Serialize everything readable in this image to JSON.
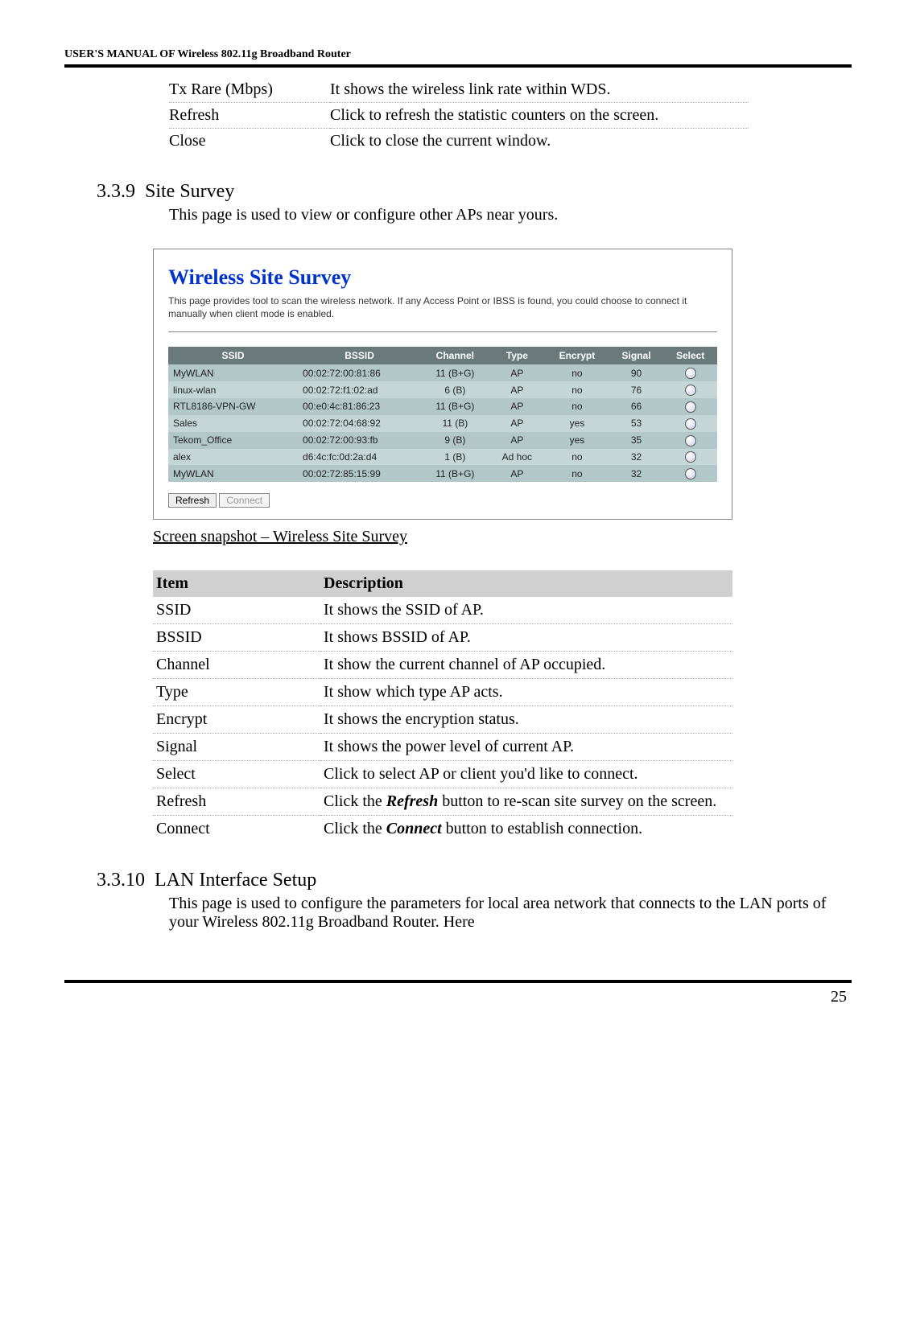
{
  "header": "USER'S MANUAL OF Wireless 802.11g Broadband Router",
  "top_defs": [
    {
      "k": "Tx Rare (Mbps)",
      "v": "It shows the wireless link rate within WDS."
    },
    {
      "k": "Refresh",
      "v": "Click to refresh the statistic counters on the screen."
    },
    {
      "k": "Close",
      "v": "Click to close the current window."
    }
  ],
  "section_survey": {
    "num": "3.3.9",
    "title": "Site Survey",
    "intro": "This page is used to view or configure other APs near yours."
  },
  "survey_panel": {
    "title": "Wireless Site Survey",
    "desc": "This page provides tool to scan the wireless network. If any Access Point or IBSS is found, you could choose to connect it manually when client mode is enabled.",
    "headers": [
      "SSID",
      "BSSID",
      "Channel",
      "Type",
      "Encrypt",
      "Signal",
      "Select"
    ],
    "rows": [
      [
        "MyWLAN",
        "00:02:72:00:81:86",
        "11 (B+G)",
        "AP",
        "no",
        "90"
      ],
      [
        "linux-wlan",
        "00:02:72:f1:02:ad",
        "6 (B)",
        "AP",
        "no",
        "76"
      ],
      [
        "RTL8186-VPN-GW",
        "00:e0:4c:81:86:23",
        "11 (B+G)",
        "AP",
        "no",
        "66"
      ],
      [
        "Sales",
        "00:02:72:04:68:92",
        "11 (B)",
        "AP",
        "yes",
        "53"
      ],
      [
        "Tekom_Office",
        "00:02:72:00:93:fb",
        "9 (B)",
        "AP",
        "yes",
        "35"
      ],
      [
        "alex",
        "d6:4c:fc:0d:2a:d4",
        "1 (B)",
        "Ad hoc",
        "no",
        "32"
      ],
      [
        "MyWLAN",
        "00:02:72:85:15:99",
        "11 (B+G)",
        "AP",
        "no",
        "32"
      ]
    ],
    "btn_refresh": "Refresh",
    "btn_connect": "Connect"
  },
  "caption": "Screen snapshot – Wireless Site Survey",
  "desc_table": {
    "headers": {
      "item": "Item",
      "desc": "Description"
    },
    "rows": [
      {
        "k": "SSID",
        "v": "It shows the SSID of AP."
      },
      {
        "k": "BSSID",
        "v": "It shows BSSID of AP."
      },
      {
        "k": "Channel",
        "v": "It show the current channel of AP occupied."
      },
      {
        "k": "Type",
        "v": "It show which type AP acts."
      },
      {
        "k": "Encrypt",
        "v": "It shows the encryption status."
      },
      {
        "k": "Signal",
        "v": "It shows the power level of current AP."
      },
      {
        "k": "Select",
        "v": "Click to select AP or client you'd like to connect."
      },
      {
        "k": "Refresh",
        "pre": "Click the ",
        "bi": "Refresh",
        "post": " button to re-scan site survey on the screen."
      },
      {
        "k": "Connect",
        "pre": "Click the ",
        "bi": "Connect",
        "post": " button to establish connection."
      }
    ]
  },
  "section_lan": {
    "num": "3.3.10",
    "title": "LAN Interface Setup",
    "body1": "This page is used to configure the parameters for local area network that connects to the LAN ports of your Wireless 802.11g Broadband Router. Here"
  },
  "page_number": "25"
}
